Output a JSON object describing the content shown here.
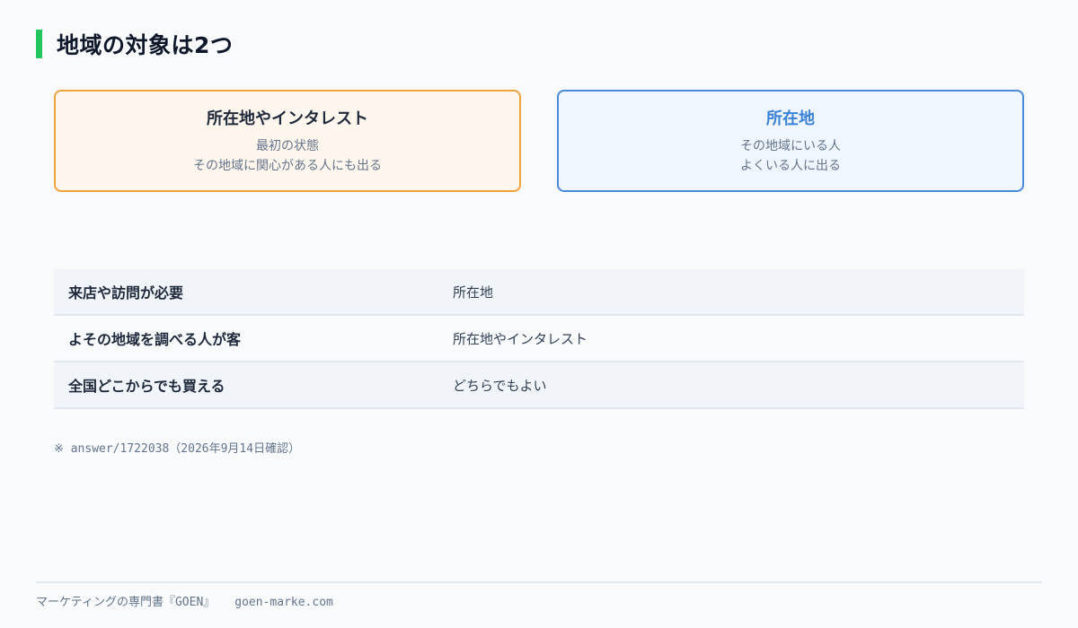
{
  "header": {
    "title": "地域の対象は2つ",
    "accent_color": "#22c55e"
  },
  "cards": [
    {
      "title": "所在地やインタレスト",
      "lines": [
        "最初の状態",
        "その地域に関心がある人にも出る"
      ],
      "accent_color": "#f0a13a"
    },
    {
      "title": "所在地",
      "lines": [
        "その地域にいる人",
        "よくいる人に出る"
      ],
      "accent_color": "#4a8ad8"
    }
  ],
  "table": {
    "rows": [
      {
        "condition": "来店や訪問が必要",
        "target": "所在地"
      },
      {
        "condition": "よその地域を調べる人が客",
        "target": "所在地やインタレスト"
      },
      {
        "condition": "全国どこからでも買える",
        "target": "どちらでもよい"
      }
    ]
  },
  "note": "※ answer/1722038（2026年9月14日確認）",
  "footer": {
    "brand": "マーケティングの専門書『GOEN』",
    "site": "goen-marke.com"
  }
}
